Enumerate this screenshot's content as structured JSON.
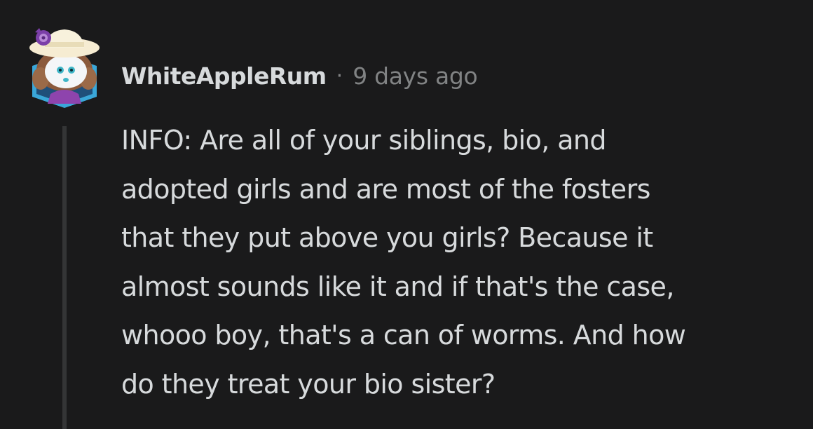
{
  "comment": {
    "username": "WhiteAppleRum",
    "separator": "·",
    "timestamp": "9 days ago",
    "avatar_icon": "snoo-avatar-sunhat-icon",
    "body_lines": [
      "INFO: Are all of your siblings, bio, and",
      "adopted girls and are most of the fosters",
      "that they put above you girls? Because it",
      "almost sounds like it and if that's the case,",
      "whooo boy, that's a can of worms. And how",
      "do they treat your bio sister?"
    ]
  },
  "colors": {
    "background": "#1a1a1b",
    "text": "#d7dadc",
    "meta_text": "#818384",
    "thread_line": "#343536",
    "avatar_accent": "#8e44ad"
  }
}
